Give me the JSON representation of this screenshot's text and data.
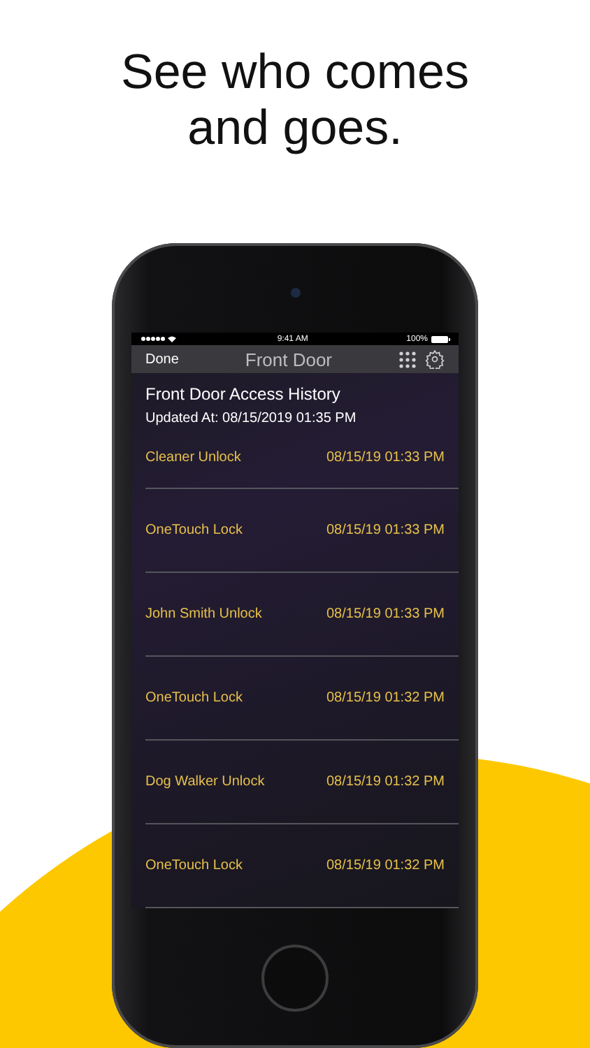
{
  "headline": "See who comes\nand goes.",
  "status_bar": {
    "time": "9:41 AM",
    "battery": "100%"
  },
  "nav_bar": {
    "done": "Done",
    "title": "Front Door"
  },
  "history": {
    "title": "Front Door Access History",
    "updated": "Updated At: 08/15/2019 01:35 PM"
  },
  "events": [
    {
      "name": "Cleaner Unlock",
      "time": "08/15/19 01:33 PM"
    },
    {
      "name": "OneTouch Lock",
      "time": "08/15/19 01:33 PM"
    },
    {
      "name": "John Smith Unlock",
      "time": "08/15/19 01:33 PM"
    },
    {
      "name": "OneTouch Lock",
      "time": "08/15/19 01:32 PM"
    },
    {
      "name": "Dog Walker Unlock",
      "time": "08/15/19 01:32 PM"
    },
    {
      "name": "OneTouch Lock",
      "time": "08/15/19 01:32 PM"
    }
  ]
}
